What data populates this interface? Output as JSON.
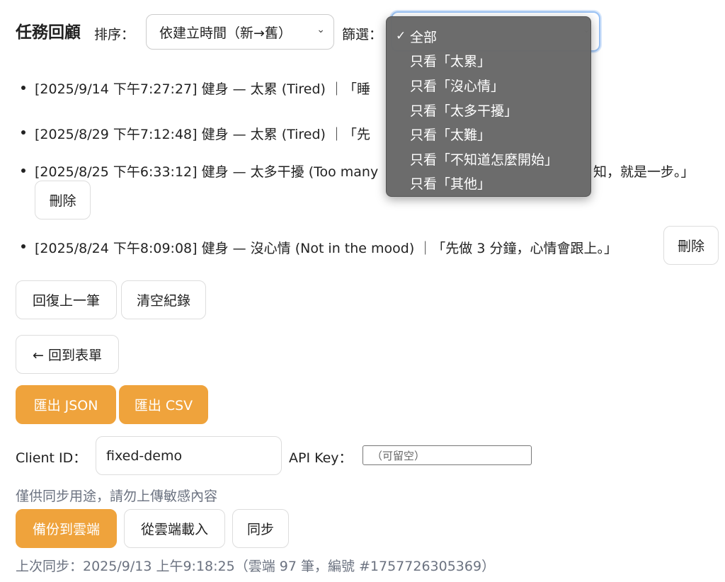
{
  "header": {
    "title": "任務回顧",
    "sort_label": "排序：",
    "sort_value": "依建立時間（新→舊）",
    "filter_label": "篩選："
  },
  "filter_menu": {
    "options": [
      "全部",
      "只看「太累」",
      "只看「沒心情」",
      "只看「太多干擾」",
      "只看「太難」",
      "只看「不知道怎麼開始」",
      "只看「其他」"
    ],
    "selected_index": 0
  },
  "entries": [
    {
      "text": "[2025/9/14 下午7:27:27] 健身 — 太累 (Tired) ｜「睡"
    },
    {
      "text": "[2025/8/29 下午7:12:48] 健身 — 太累 (Tired) ｜「先"
    },
    {
      "text": "[2025/8/25 下午6:33:12] 健身 — 太多干擾 (Too many",
      "tail": "知，就是一步。」",
      "delete_label": "刪除"
    },
    {
      "text": "[2025/8/24 下午8:09:08] 健身 — 沒心情 (Not in the mood) ｜「先做 3 分鐘，心情會跟上。」",
      "delete_label": "刪除"
    }
  ],
  "actions": {
    "undo": "回復上一筆",
    "clear": "清空紀錄",
    "back": "← 回到表單",
    "export_json": "匯出 JSON",
    "export_csv": "匯出 CSV"
  },
  "sync": {
    "client_id_label": "Client ID：",
    "client_id_value": "fixed-demo",
    "api_key_label": "API Key：",
    "api_key_placeholder": "（可留空）",
    "note": "僅供同步用途，請勿上傳敏感內容",
    "backup": "備份到雲端",
    "load": "從雲端載入",
    "sync": "同步",
    "last_sync": "上次同步：2025/9/13 上午9:18:25（雲端 97 筆，編號 #1757726305369）"
  },
  "colors": {
    "accent": "#efa33c",
    "menu_bg": "#696969",
    "focus_ring": "#9cc3f4"
  }
}
